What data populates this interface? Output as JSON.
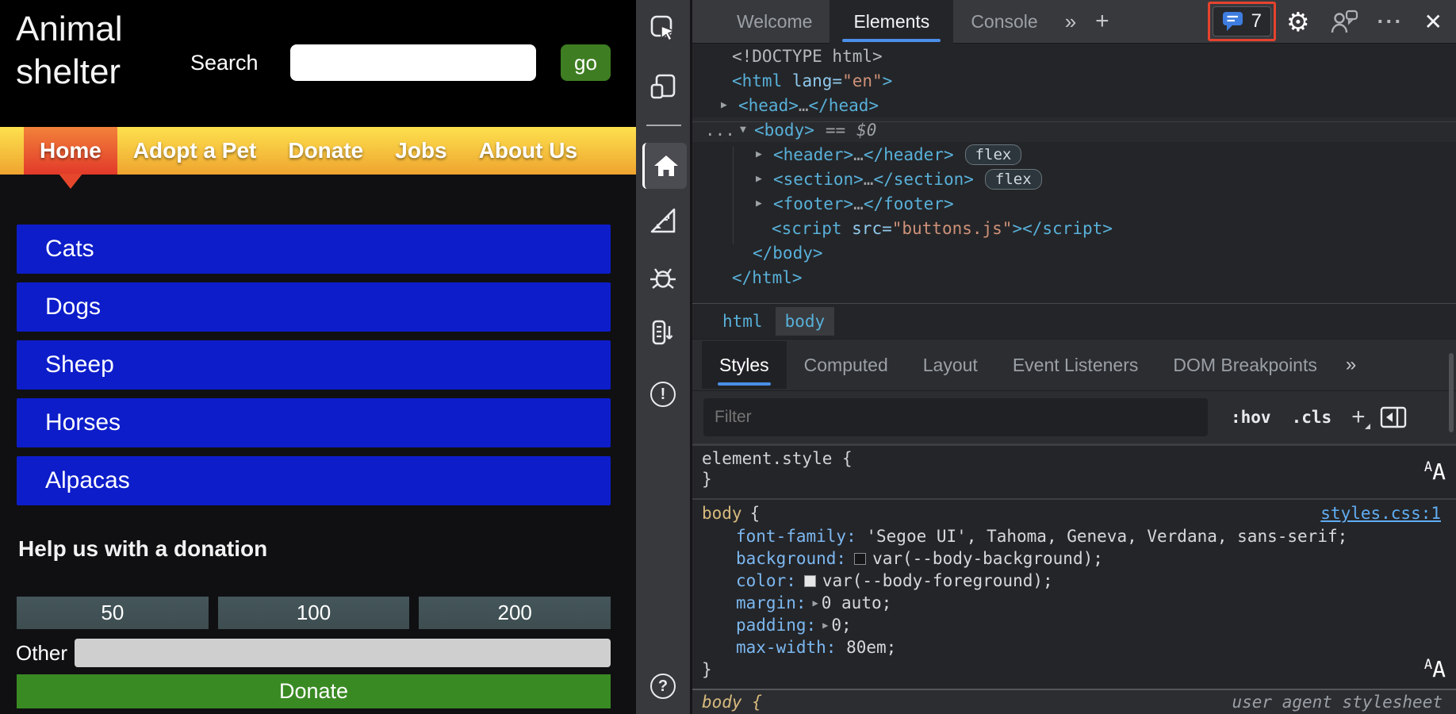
{
  "colors": {
    "cat_blue": "#0d1dca",
    "nav_yellow_top": "#fde14e",
    "nav_orange_bottom": "#efa42f",
    "home_tab_top": "#f2823a",
    "home_tab_bottom": "#e2392a",
    "home_arrow": "#e6472c",
    "go_green": "#3e7d22",
    "donate_green": "#3a8a23",
    "preset_slate": "#3d4d50",
    "other_input_gray": "#cfcfcf",
    "devtools_accent_blue": "#4a8fe8",
    "highlight_red": "#e5432e",
    "badge_chat_blue": "#3e7de0",
    "tag_blue": "#58b0d9",
    "attr_name_blue": "#8fc9ed",
    "attr_value_orange": "#ce9178",
    "selector_gold": "#d7ba7d",
    "prop_name_blue": "#7cb8f0",
    "link_blue": "#61aef3"
  },
  "page": {
    "title": "Animal shelter",
    "search_label": "Search",
    "search_value": "",
    "go_label": "go",
    "nav": [
      "Home",
      "Adopt a Pet",
      "Donate",
      "Jobs",
      "About Us"
    ],
    "categories": [
      "Cats",
      "Dogs",
      "Sheep",
      "Horses",
      "Alpacas"
    ],
    "donation": {
      "heading": "Help us with a donation",
      "presets": [
        "50",
        "100",
        "200"
      ],
      "other_label": "Other",
      "other_value": "",
      "donate_label": "Donate"
    }
  },
  "devtools": {
    "tabs": [
      "Welcome",
      "Elements",
      "Console"
    ],
    "issues_count": "7",
    "icons": {
      "more_tabs": "»",
      "add_tab": "+",
      "settings": "⚙",
      "overflow": "···",
      "close": "✕",
      "help": "?",
      "alert": "!",
      "collapsed_arrow": "▶",
      "expanded_arrow": "▼",
      "expand_value_arrow": "▶",
      "inline_ellipsis": "…",
      "gutter_ellipsis": "...",
      "font_size_small_a": "A",
      "font_size_large_a": "A"
    },
    "dom": {
      "doctype": "<!DOCTYPE html>",
      "html_open": "<html",
      "lang_attr": " lang=",
      "lang_value": "\"en\"",
      "gt": ">",
      "head_open": "<head>",
      "head_close": "</head>",
      "body_open": "<body>",
      "eq": "==",
      "dollar_zero": "$0",
      "header_open": "<header>",
      "header_close": "</header>",
      "section_open": "<section>",
      "section_close": "</section>",
      "footer_open": "<footer>",
      "footer_close": "</footer>",
      "script_open": "<script",
      "src_attr": " src=",
      "src_value": "\"buttons.js\"",
      "script_close": "</script>",
      "body_close": "</body>",
      "html_close": "</html>",
      "flex_badge": "flex"
    },
    "breadcrumb": [
      "html",
      "body"
    ],
    "styles_tabs": [
      "Styles",
      "Computed",
      "Layout",
      "Event Listeners",
      "DOM Breakpoints"
    ],
    "filter_placeholder": "Filter",
    "pseudo_toggle": ":hov",
    "class_toggle": ".cls",
    "css": {
      "element_style": {
        "selector": "element.style {",
        "close": "}"
      },
      "body_rule": {
        "selector": "body",
        "brace": "{",
        "close": "}",
        "source": "styles.css:1",
        "props": [
          {
            "name": "font-family:",
            "value": "'Segoe UI', Tahoma, Geneva, Verdana, sans-serif;"
          },
          {
            "name": "background:",
            "value": "var(--body-background);"
          },
          {
            "name": "color:",
            "value": "var(--body-foreground);"
          },
          {
            "name": "margin:",
            "value": "0 auto;"
          },
          {
            "name": "padding:",
            "value": "0;"
          },
          {
            "name": "max-width:",
            "value": "80em;"
          }
        ]
      },
      "ua_rule": {
        "selector": "body {",
        "source": "user agent stylesheet"
      }
    }
  }
}
